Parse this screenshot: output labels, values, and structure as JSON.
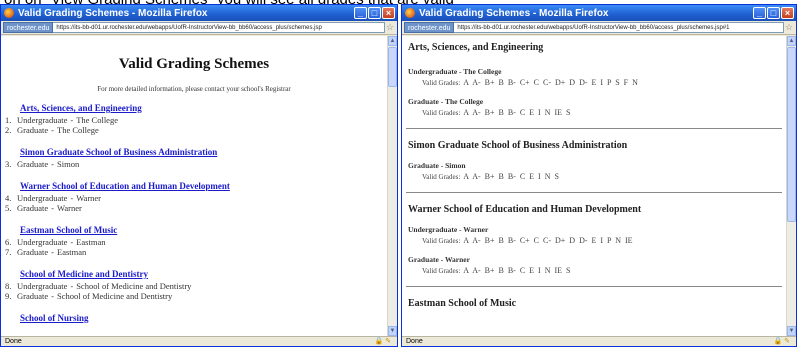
{
  "caption": "on on \"View Grading Schemes\" you will see all grades that are valid",
  "left_window": {
    "title": "Valid Grading Schemes - Mozilla Firefox",
    "site_identity": "rochester.edu",
    "url": "https://its-bb-d01.ur.rochester.edu/webapps/UofR-InstructorView-bb_bb60/access_plus/schemes.jsp",
    "status": "Done",
    "page_title": "Valid Grading Schemes",
    "subtitle": "For more detailed information, please contact your school's Registrar",
    "sections": [
      {
        "name": "Arts, Sciences, and Engineering",
        "items": [
          {
            "num": "1.",
            "level": "Undergraduate",
            "school": "The College"
          },
          {
            "num": "2.",
            "level": "Graduate",
            "school": "The College"
          }
        ]
      },
      {
        "name": "Simon Graduate School of Business Administration",
        "items": [
          {
            "num": "3.",
            "level": "Graduate",
            "school": "Simon"
          }
        ]
      },
      {
        "name": "Warner School of Education and Human Development",
        "items": [
          {
            "num": "4.",
            "level": "Undergraduate",
            "school": "Warner"
          },
          {
            "num": "5.",
            "level": "Graduate",
            "school": "Warner"
          }
        ]
      },
      {
        "name": "Eastman School of Music",
        "items": [
          {
            "num": "6.",
            "level": "Undergraduate",
            "school": "Eastman"
          },
          {
            "num": "7.",
            "level": "Graduate",
            "school": "Eastman"
          }
        ]
      },
      {
        "name": "School of Medicine and Dentistry",
        "items": [
          {
            "num": "8.",
            "level": "Undergraduate",
            "school": "School of Medicine and Dentistry"
          },
          {
            "num": "9.",
            "level": "Graduate",
            "school": "School of Medicine and Dentistry"
          }
        ]
      },
      {
        "name": "School of Nursing",
        "items": []
      }
    ]
  },
  "right_window": {
    "title": "Valid Grading Schemes - Mozilla Firefox",
    "site_identity": "rochester.edu",
    "url": "https://its-bb-d01.ur.rochester.edu/webapps/UofR-InstructorView-bb_bb60/access_plus/schemes.jsp#1",
    "status": "Done",
    "grades_label": "Valid Grades:",
    "sections": [
      {
        "name": "Arts, Sciences, and Engineering",
        "levels": [
          {
            "label": "Undergraduate - The College",
            "grades": "A  A-  B+  B  B-  C+  C  C-  D+  D  D-  E  I  P  S  F  N"
          },
          {
            "label": "Graduate - The College",
            "grades": "A  A-  B+  B  B-  C  E  I  N  IE  S"
          }
        ]
      },
      {
        "name": "Simon Graduate School of Business Administration",
        "levels": [
          {
            "label": "Graduate - Simon",
            "grades": "A  A-  B+  B  B-  C  E  I  N  S"
          }
        ]
      },
      {
        "name": "Warner School of Education and Human Development",
        "levels": [
          {
            "label": "Undergraduate - Warner",
            "grades": "A  A-  B+  B  B-  C+  C  C-  D+  D  D-  E  I  P  N  IE"
          },
          {
            "label": "Graduate - Warner",
            "grades": "A  A-  B+  B  B-  C  E  I  N  IE  S"
          }
        ]
      },
      {
        "name": "Eastman School of Music",
        "levels": []
      }
    ]
  }
}
